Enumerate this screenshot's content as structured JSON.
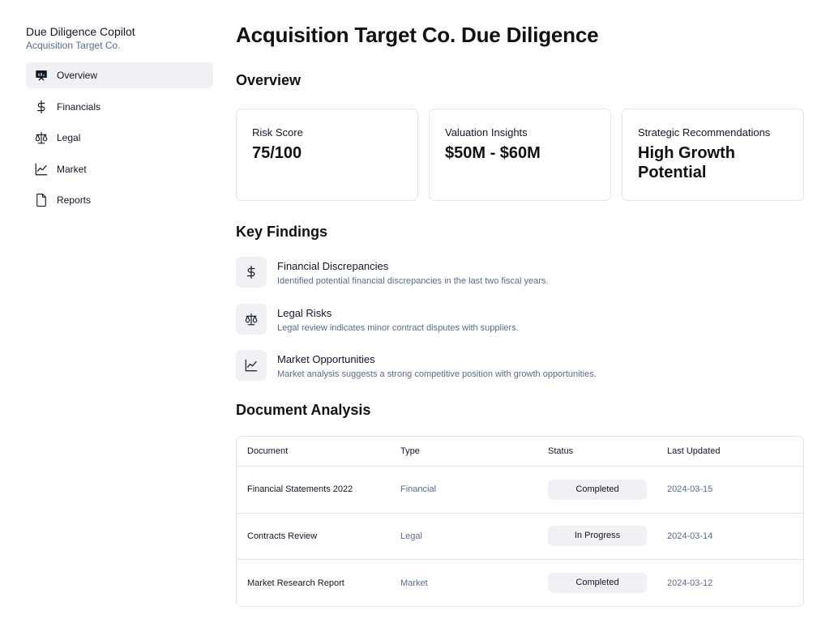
{
  "sidebar": {
    "app_title": "Due Diligence Copilot",
    "app_subtitle": "Acquisition Target Co.",
    "items": [
      {
        "label": "Overview",
        "icon": "presentation-chart-icon",
        "active": true
      },
      {
        "label": "Financials",
        "icon": "dollar-icon",
        "active": false
      },
      {
        "label": "Legal",
        "icon": "scale-icon",
        "active": false
      },
      {
        "label": "Market",
        "icon": "line-chart-icon",
        "active": false
      },
      {
        "label": "Reports",
        "icon": "document-icon",
        "active": false
      }
    ]
  },
  "main": {
    "title": "Acquisition Target Co. Due Diligence",
    "overview": {
      "heading": "Overview",
      "cards": [
        {
          "label": "Risk Score",
          "value": "75/100"
        },
        {
          "label": "Valuation Insights",
          "value": "$50M - $60M"
        },
        {
          "label": "Strategic Recommendations",
          "value": "High Growth Potential"
        }
      ]
    },
    "key_findings": {
      "heading": "Key Findings",
      "items": [
        {
          "title": "Financial Discrepancies",
          "description": "Identified potential financial discrepancies in the last two fiscal years.",
          "icon": "dollar-icon"
        },
        {
          "title": "Legal Risks",
          "description": "Legal review indicates minor contract disputes with suppliers.",
          "icon": "scale-icon"
        },
        {
          "title": "Market Opportunities",
          "description": "Market analysis suggests a strong competitive position with growth opportunities.",
          "icon": "line-chart-icon"
        }
      ]
    },
    "document_analysis": {
      "heading": "Document Analysis",
      "columns": [
        "Document",
        "Type",
        "Status",
        "Last Updated"
      ],
      "rows": [
        {
          "document": "Financial Statements 2022",
          "type": "Financial",
          "status": "Completed",
          "updated": "2024-03-15"
        },
        {
          "document": "Contracts Review",
          "type": "Legal",
          "status": "In Progress",
          "updated": "2024-03-14"
        },
        {
          "document": "Market Research Report",
          "type": "Market",
          "status": "Completed",
          "updated": "2024-03-12"
        }
      ]
    }
  },
  "colors": {
    "accent_muted": "#5b6b8c",
    "surface": "#f1f1f5",
    "border": "#e3e4e8"
  }
}
